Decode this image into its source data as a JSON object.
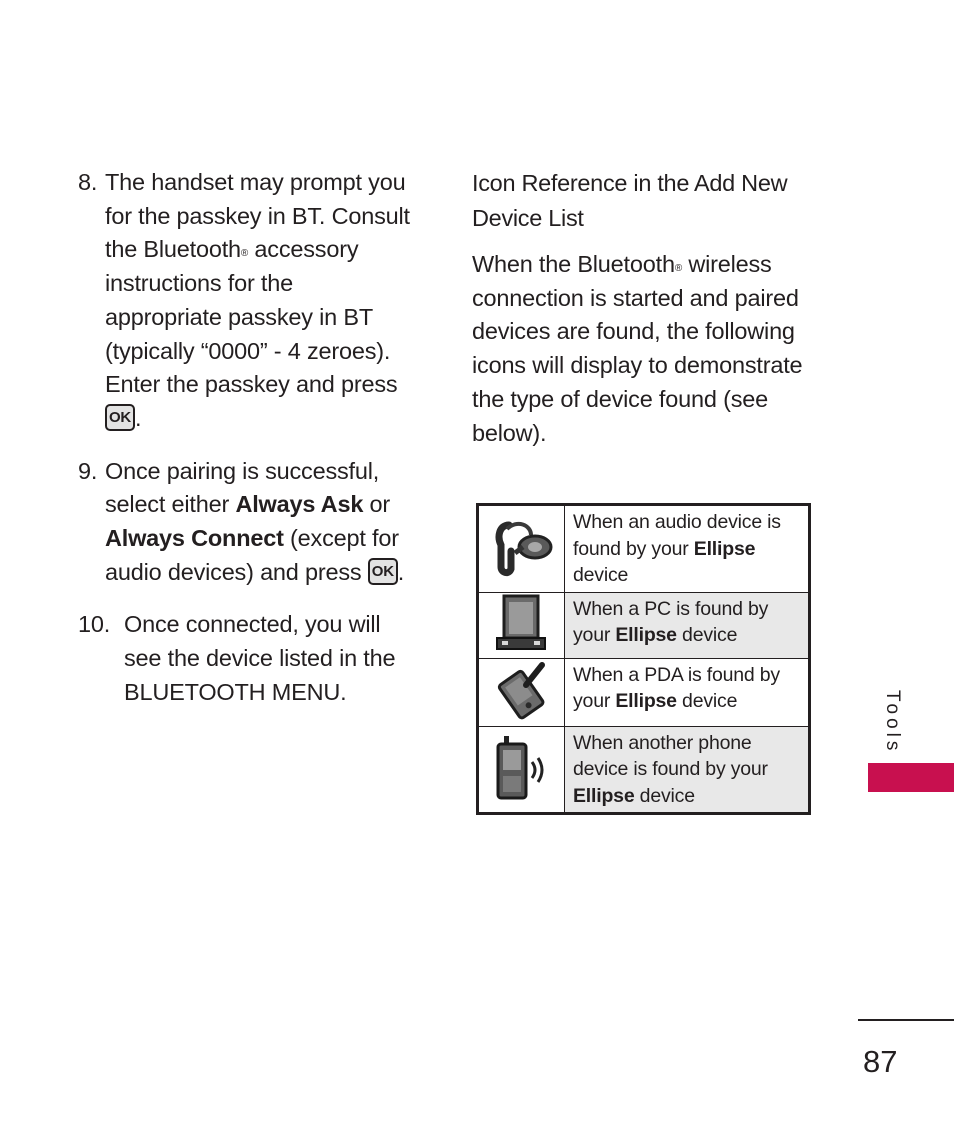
{
  "steps": [
    {
      "number": "8.",
      "lines": [
        "The handset may prompt you",
        "for the passkey in BT. Consult",
        "the Bluetooth",
        "accessory",
        "instructions for the",
        "appropriate passkey in BT",
        "(typically “0000” - 4 zeroes).",
        "Enter the passkey and press"
      ],
      "registered": "®",
      "key_label": "OK",
      "end": "."
    },
    {
      "number": "9.",
      "line1": "Once pairing is successful,",
      "line2_pre": "select either ",
      "line2_bold": "Always Ask",
      "line2_post": " or",
      "line3_bold": "Always Connect",
      "line3_post": " (except for",
      "line4": "audio devices) and press ",
      "key_label": "OK",
      "end": "."
    },
    {
      "number": "10.",
      "lines": [
        "Once connected, you will",
        "see the device listed in the",
        "BLUETOOTH MENU."
      ]
    }
  ],
  "right": {
    "heading_line1": "Icon Reference in the Add New",
    "heading_line2": "Device List",
    "para_line1_pre": "When the Bluetooth",
    "registered": "®",
    "para_line1_post": " wireless",
    "para_lines": [
      "connection is started and paired",
      "devices are found, the following",
      "icons will display to demonstrate",
      "the type of device found (see",
      "below)."
    ]
  },
  "icon_table": [
    {
      "icon": "audio-device-icon",
      "pre": "When an audio device is found by your ",
      "bold": "Ellipse",
      "post": " device",
      "shaded": false
    },
    {
      "icon": "pc-icon",
      "pre": "When a PC is found by your ",
      "bold": "Ellipse",
      "post": " device",
      "shaded": true
    },
    {
      "icon": "pda-icon",
      "pre": "When a PDA is found by your ",
      "bold": "Ellipse",
      "post": " device",
      "shaded": false
    },
    {
      "icon": "phone-icon",
      "pre": "When another phone device is found by your ",
      "bold": "Ellipse",
      "post": " device",
      "shaded": true
    }
  ],
  "section_tab": {
    "label": "Tools",
    "color": "#c8104f"
  },
  "page_number": "87"
}
